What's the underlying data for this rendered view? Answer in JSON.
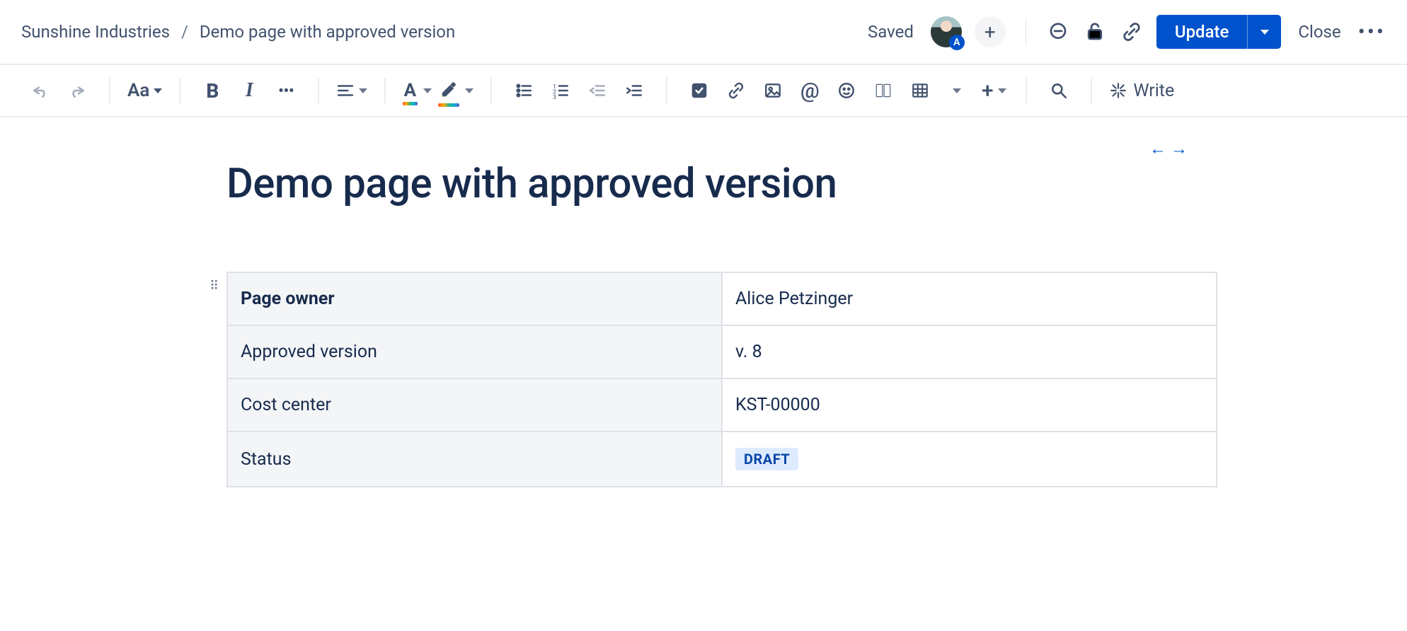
{
  "breadcrumb": {
    "space": "Sunshine Industries",
    "page": "Demo page with approved version"
  },
  "header": {
    "saved_label": "Saved",
    "avatar_initial": "A",
    "update_label": "Update",
    "close_label": "Close"
  },
  "toolbar": {
    "text_style_label": "Aa",
    "write_label": "Write"
  },
  "page": {
    "title": "Demo page with approved version"
  },
  "metadata_table": {
    "rows": [
      {
        "label": "Page owner",
        "value": "Alice Petzinger"
      },
      {
        "label": "Approved version",
        "value": "v. 8"
      },
      {
        "label": "Cost center",
        "value": "KST-00000"
      },
      {
        "label": "Status",
        "value": "DRAFT",
        "is_badge": true
      }
    ]
  },
  "colors": {
    "primary": "#0052CC",
    "text": "#172B4D"
  }
}
